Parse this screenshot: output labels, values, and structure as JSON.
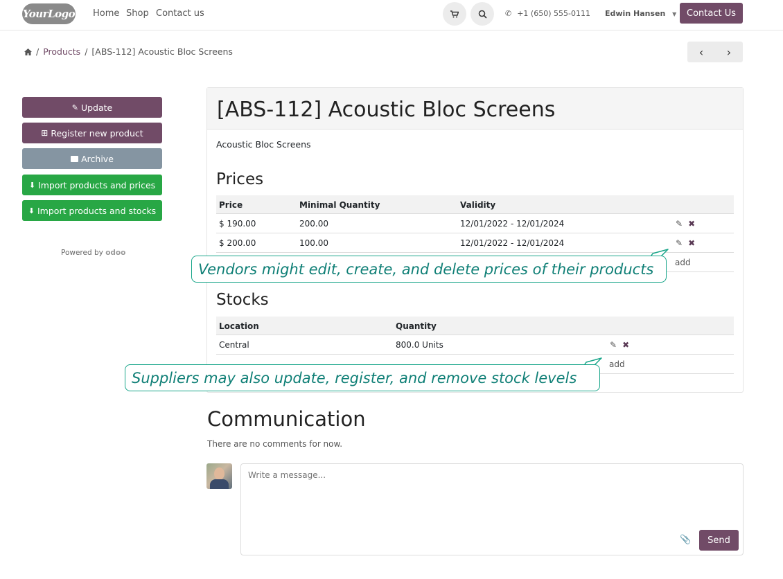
{
  "header": {
    "logo_text": "YourLogo",
    "nav": [
      "Home",
      "Shop",
      "Contact us"
    ],
    "cart_icon": "shopping-cart-icon",
    "search_icon": "search-icon",
    "phone": "+1 (650) 555-0111",
    "user": "Edwin Hansen",
    "contact_button": "Contact Us"
  },
  "breadcrumb": {
    "home_icon": "home-icon",
    "separator": "/",
    "products": "Products",
    "current": "[ABS-112] Acoustic Bloc Screens"
  },
  "sidebar": {
    "buttons": [
      "Update",
      "Register new product",
      "Archive",
      "Import products and prices",
      "Import products and stocks"
    ],
    "powered_by": "Powered by",
    "powered_brand": "odoo"
  },
  "product": {
    "title": "[ABS-112] Acoustic Bloc Screens",
    "description": "Acoustic Bloc Screens"
  },
  "prices": {
    "title": "Prices",
    "columns": [
      "Price",
      "Minimal Quantity",
      "Validity"
    ],
    "rows": [
      {
        "price": "$ 190.00",
        "min_qty": "200.00",
        "validity": "12/01/2022 - 12/01/2024"
      },
      {
        "price": "$ 200.00",
        "min_qty": "100.00",
        "validity": "12/01/2022 - 12/01/2024"
      }
    ],
    "add_label": "add"
  },
  "stocks": {
    "title": "Stocks",
    "columns": [
      "Location",
      "Quantity"
    ],
    "rows": [
      {
        "location": "Central",
        "quantity": "800.0 Units"
      }
    ],
    "add_label": "add"
  },
  "callouts": {
    "prices": "Vendors might edit, create, and delete prices of their products",
    "stocks": "Suppliers may also update, register, and remove stock levels"
  },
  "communication": {
    "title": "Communication",
    "empty_text": "There are no comments for now.",
    "placeholder": "Write a message...",
    "send_label": "Send"
  },
  "colors": {
    "brand": "#714b67",
    "success": "#28a745",
    "archive": "#8595a2",
    "callout": "#17a589"
  }
}
